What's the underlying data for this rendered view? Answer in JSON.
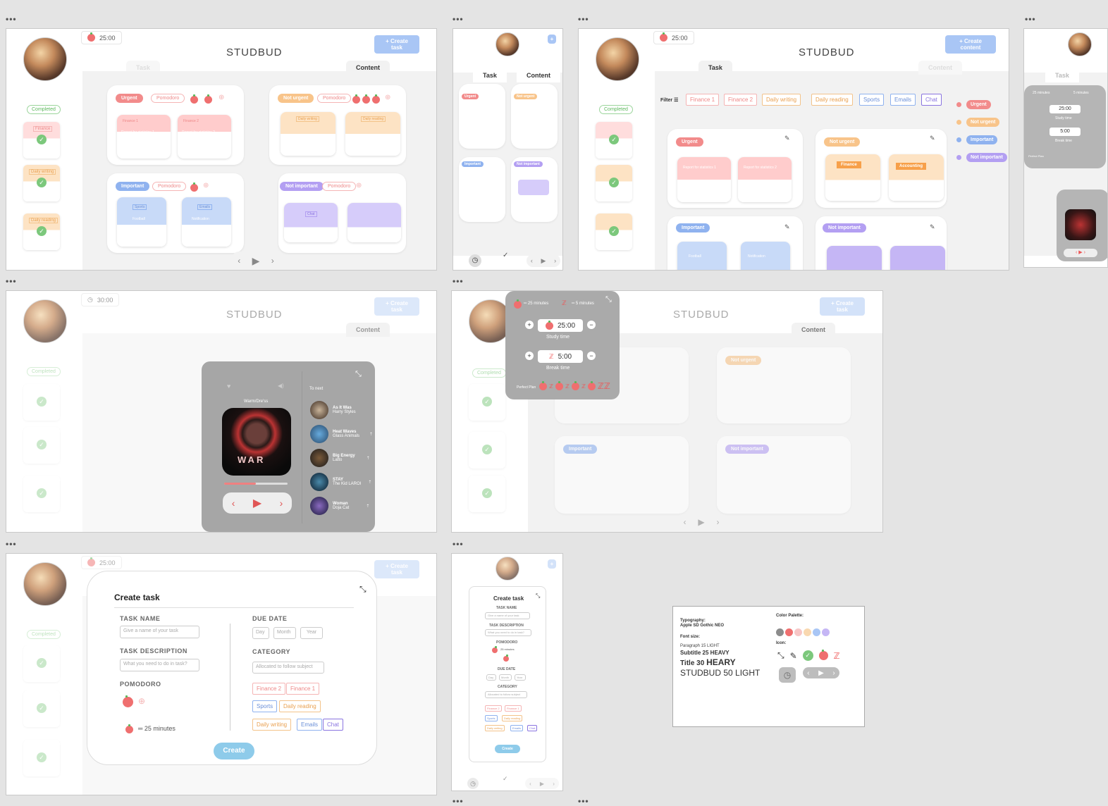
{
  "brand": "STUDBUD",
  "timer": "25:00",
  "timer_alt": "30:00",
  "create_task": "Create task",
  "create_content": "Create content",
  "tabs": {
    "task": "Task",
    "content": "Content"
  },
  "completed": "Completed",
  "side_notes": [
    "Finance",
    "Daily writing",
    "Daily reading"
  ],
  "priority": {
    "urgent": "Urgent",
    "not_urgent": "Not urgent",
    "important": "Important",
    "not_important": "Not important"
  },
  "pomodoro": "Pomodoro",
  "notes": {
    "finance1": "Finance 1",
    "finance2": "Finance 2",
    "report1": "Report for statistics 1",
    "report2": "Report for statistics 2",
    "daily_writing": "Daily writing",
    "daily_reading": "Daily reading",
    "sports": "Sports",
    "football": "Football",
    "emails": "Emails",
    "notification": "Notification",
    "chat": "Chat",
    "finance": "Finance",
    "accounting": "Accounting"
  },
  "filter": {
    "label": "Filter",
    "chips": [
      "Finance 1",
      "Finance 2",
      "Daily writing",
      "Daily reading",
      "Sports",
      "Emails",
      "Chat"
    ]
  },
  "music": {
    "now_playing": "Warm/Dre'ss",
    "to_next": "To next",
    "album_text": "WAR",
    "songs": [
      {
        "title": "As It Was",
        "artist": "Harry Styles"
      },
      {
        "title": "Heat Waves",
        "artist": "Glass Animals"
      },
      {
        "title": "Big Energy",
        "artist": "Latto"
      },
      {
        "title": "STAY",
        "artist": "The Kid LAROI"
      },
      {
        "title": "Woman",
        "artist": "Doja Cat"
      }
    ]
  },
  "pomodoro_panel": {
    "study_minutes": "25 minutes",
    "break_minutes": "5 minutes",
    "study_time_value": "25:00",
    "study_time_label": "Study time",
    "break_time_value": "5:00",
    "break_time_label": "Break time",
    "perfect_plan": "Perfect Plan"
  },
  "create_modal": {
    "title": "Create task",
    "task_name": "TASK NAME",
    "task_name_ph": "Give a name of your task",
    "task_desc": "TASK DESCRIPTION",
    "task_desc_ph": "What you need to do in task?",
    "pomodoro": "POMODORO",
    "pomodoro_summary": "25 minutes",
    "due_date": "DUE DATE",
    "day": "Day",
    "month": "Month",
    "year": "Year",
    "category": "CATEGORY",
    "category_ph": "Allocated to follow subject",
    "chips": [
      "Finance 2",
      "Finance 1",
      "Sports",
      "Daily reading",
      "Daily writing",
      "Emails",
      "Chat"
    ],
    "create": "Create"
  },
  "style_guide": {
    "typography": "Typography:",
    "font": "Apple SD Gothic NEO",
    "font_size": "Font size:",
    "paragraph": "Paragraph 15  LIGHT",
    "subtitle": "Subtitle 25 HEAVY",
    "title_a": "Title 30 ",
    "title_b": "HEARY",
    "studbud": "STUDBUD 50 LIGHT",
    "color_palette": "Color Palette:",
    "palette": [
      "#8c8c8c",
      "#ef6f6f",
      "#f7c6c6",
      "#f9d8b0",
      "#a9c6f5",
      "#c5b6f5"
    ],
    "icon": "Icon:"
  }
}
